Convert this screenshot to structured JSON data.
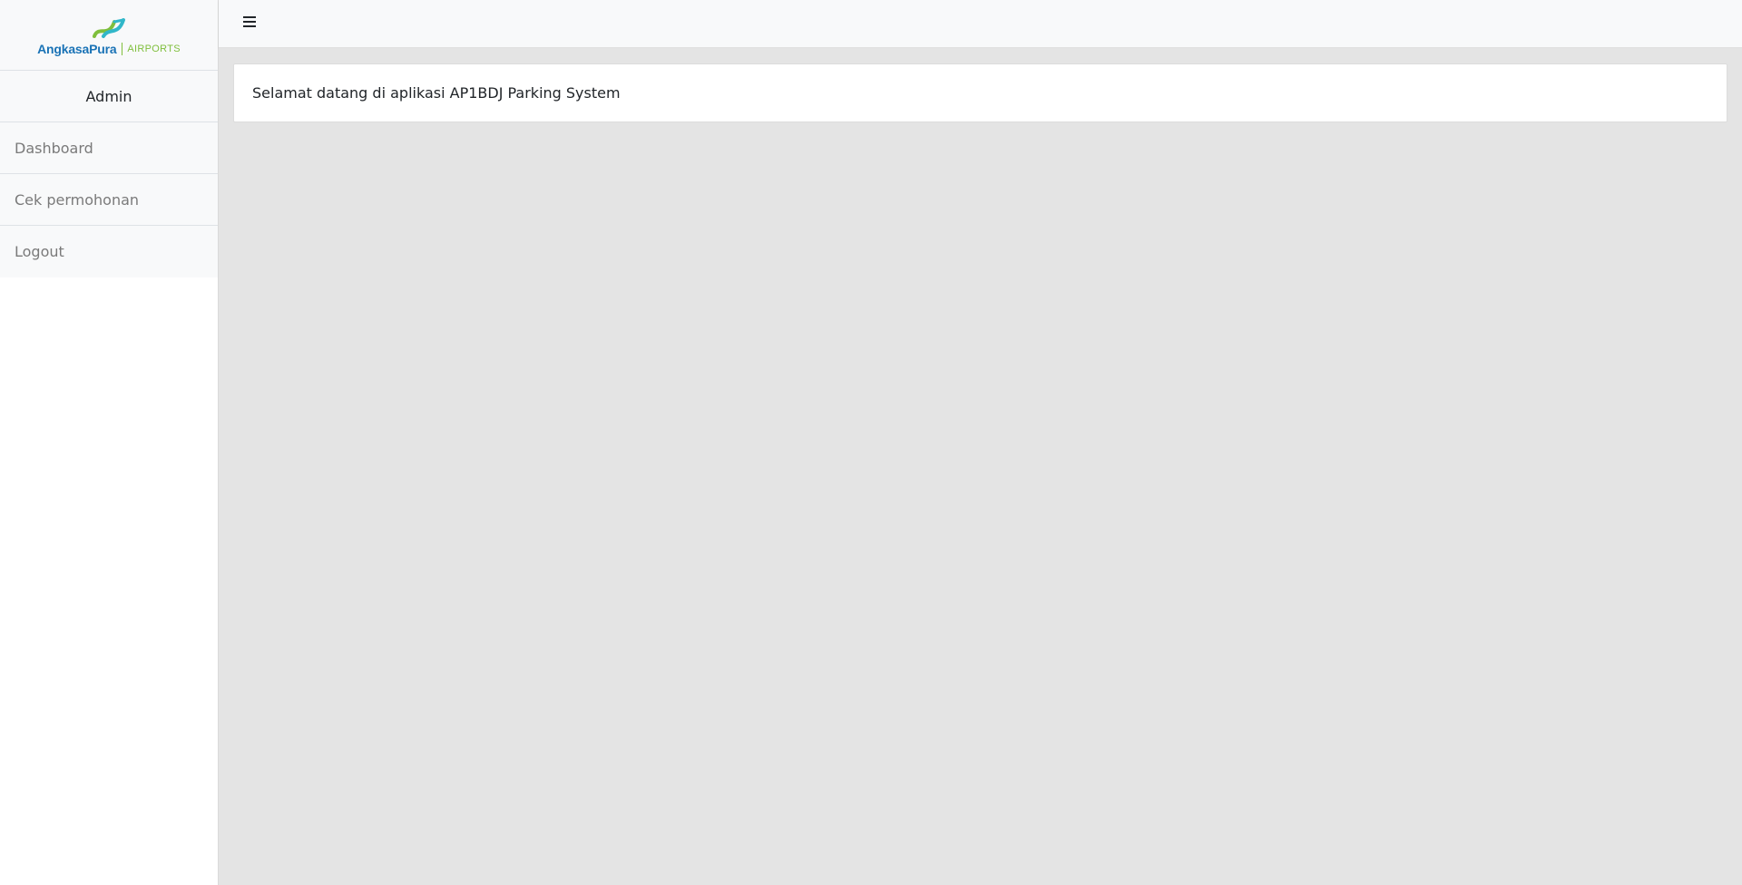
{
  "brand": {
    "name": "AngkasaPura",
    "sub": "AIRPORTS",
    "colors": {
      "blue": "#1a73b6",
      "green": "#7fbf3c",
      "teal": "#31b7c9"
    }
  },
  "sidebar": {
    "heading": "Admin",
    "items": [
      {
        "label": "Dashboard"
      },
      {
        "label": "Cek permohonan"
      },
      {
        "label": "Logout"
      }
    ]
  },
  "topbar": {
    "toggle_icon": "hamburger-icon"
  },
  "main": {
    "welcome_text": "Selamat datang di aplikasi AP1BDJ Parking System"
  }
}
